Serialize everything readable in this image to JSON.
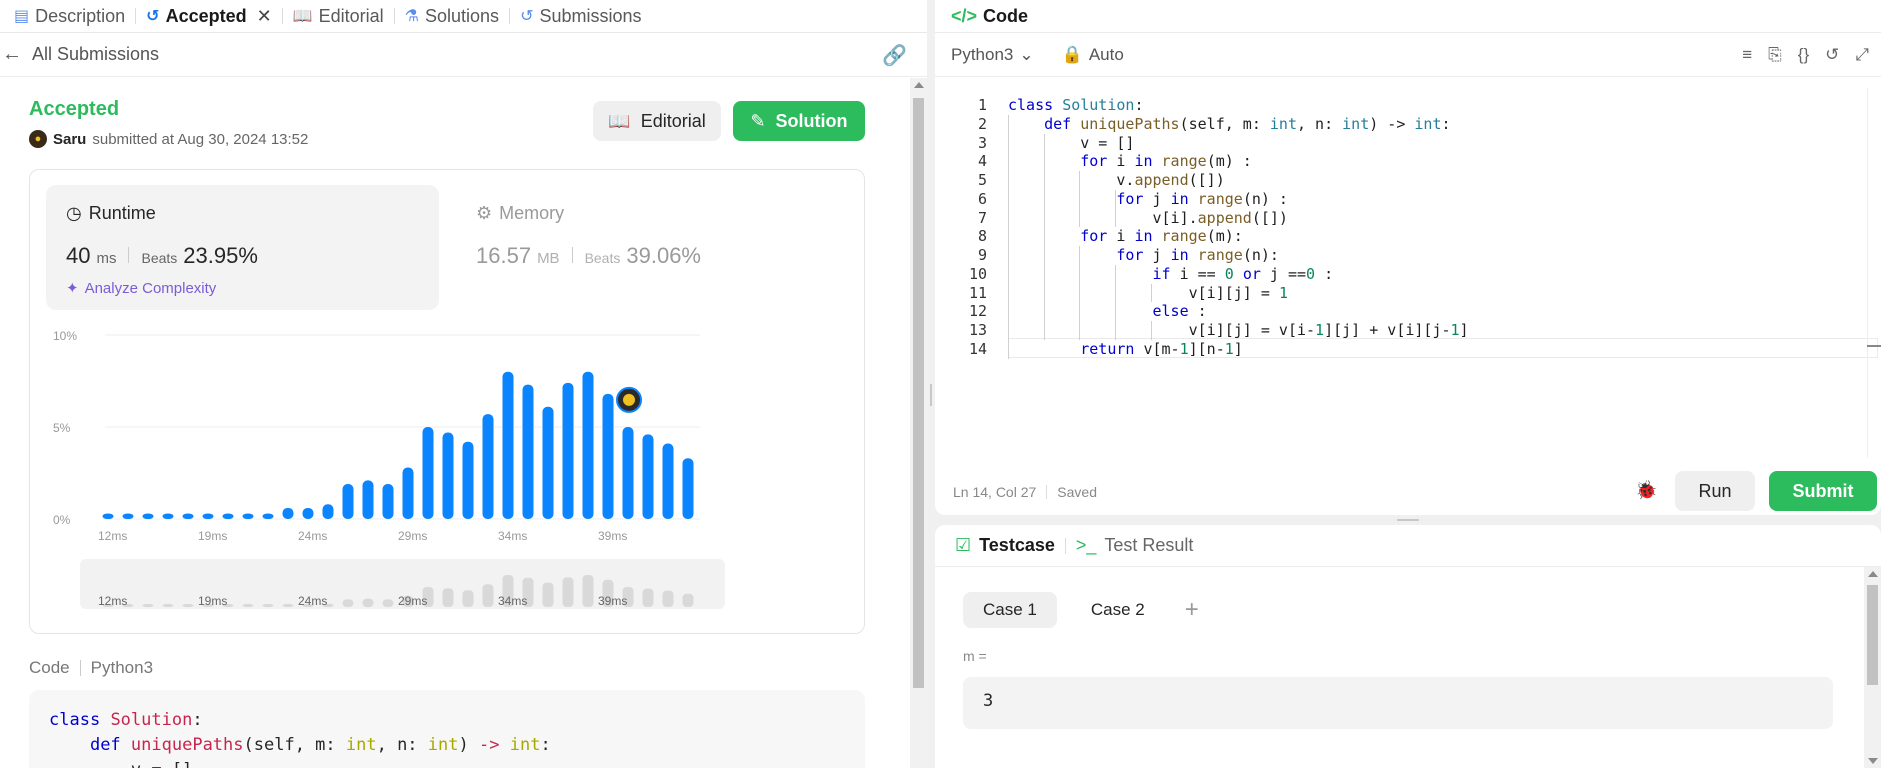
{
  "left_tabs": [
    {
      "label": "Description",
      "icon": "description-icon"
    },
    {
      "label": "Accepted",
      "icon": "history-icon",
      "active": true
    },
    {
      "label": "Editorial",
      "icon": "book-icon"
    },
    {
      "label": "Solutions",
      "icon": "flask-icon"
    },
    {
      "label": "Submissions",
      "icon": "history-icon"
    }
  ],
  "close_glyph": "✕",
  "back_label": "All Submissions",
  "submission": {
    "status": "Accepted",
    "user": "Saru",
    "submitted_text": "submitted at Aug 30, 2024 13:52",
    "editorial_btn": "Editorial",
    "solution_btn": "Solution"
  },
  "runtime": {
    "title": "Runtime",
    "value": "40",
    "unit": "ms",
    "beats_label": "Beats",
    "beats_value": "23.95%",
    "analyze": "Analyze Complexity"
  },
  "memory": {
    "title": "Memory",
    "value": "16.57",
    "unit": "MB",
    "beats_label": "Beats",
    "beats_value": "39.06%"
  },
  "chart_data": {
    "type": "bar",
    "y_ticks": [
      "10%",
      "5%",
      "0%"
    ],
    "ylim": [
      0,
      10
    ],
    "x_tick_labels": [
      "12ms",
      "19ms",
      "24ms",
      "29ms",
      "34ms",
      "39ms"
    ],
    "x_tick_indices": [
      0,
      5,
      10,
      15,
      20,
      25
    ],
    "values": [
      0.3,
      0.3,
      0.3,
      0.3,
      0.3,
      0.3,
      0.3,
      0.3,
      0.3,
      0.6,
      0.6,
      0.8,
      1.9,
      2.1,
      1.9,
      2.8,
      5.0,
      4.7,
      4.2,
      5.7,
      8.0,
      7.3,
      6.1,
      7.4,
      8.0,
      6.8,
      5.0,
      4.6,
      4.1,
      3.3
    ],
    "highlight_index": 25,
    "highlight_label": "40 ms",
    "bar_color": "#0a84ff",
    "overview_color": "#d9d9d9"
  },
  "code_preview": {
    "label": "Code",
    "lang": "Python3",
    "lines": [
      "class Solution:",
      "    def uniquePaths(self, m: int, n: int) -> int:",
      "        v = []"
    ]
  },
  "editor": {
    "title": "Code",
    "language": "Python3",
    "mode": "Auto",
    "status_pos": "Ln 14, Col 27",
    "status_saved": "Saved",
    "run_label": "Run",
    "submit_label": "Submit"
  },
  "code_lines": [
    "class Solution:",
    "    def uniquePaths(self, m: int, n: int) -> int:",
    "        v = []",
    "        for i in range(m) :",
    "            v.append([])",
    "            for j in range(n) :",
    "                v[i].append([])",
    "        for i in range(m):",
    "            for j in range(n):",
    "                if i == 0 or j ==0 :",
    "                    v[i][j] = 1",
    "                else :",
    "                    v[i][j] = v[i-1][j] + v[i][j-1]",
    "        return v[m-1][n-1]"
  ],
  "testcase": {
    "tab_active": "Testcase",
    "tab_inactive": "Test Result",
    "cases": [
      "Case 1",
      "Case 2"
    ],
    "plus": "+",
    "var_label": "m =",
    "var_value": "3"
  },
  "colors": {
    "accent_green": "#2cbb5d",
    "purple": "#7c5cd6"
  }
}
